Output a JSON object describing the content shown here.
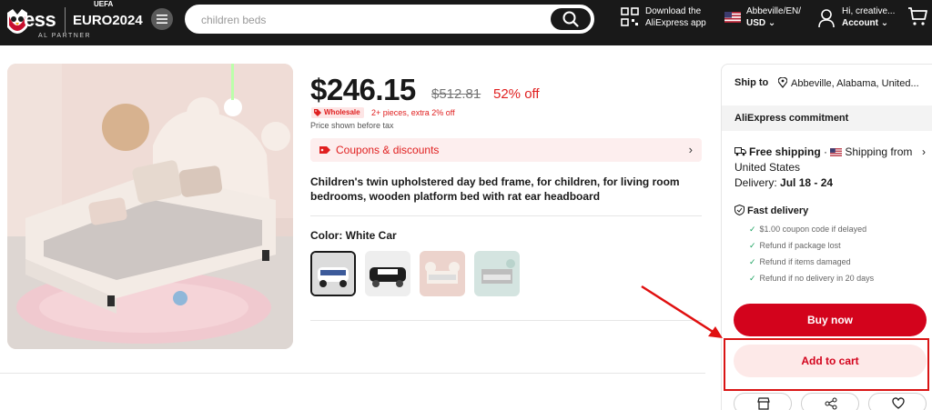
{
  "header": {
    "logo_text": "ess",
    "logo_euro": "EURO2024",
    "logo_uefa": "UEFA",
    "logo_partner": "AL PARTNER",
    "search": {
      "placeholder": "children beds"
    },
    "download": {
      "line1": "Download the",
      "line2": "AliExpress app"
    },
    "region": {
      "line1": "Abbeville/EN/",
      "line2": "USD"
    },
    "account": {
      "line1": "Hi, creative...",
      "line2": "Account"
    }
  },
  "product": {
    "price": "$246.15",
    "original_price": "$512.81",
    "discount": "52% off",
    "wholesale_badge": "Wholesale",
    "wholesale_note": "2+ pieces, extra 2% off",
    "tax_note": "Price shown before tax",
    "coupons_label": "Coupons & discounts",
    "title": "Children's twin upholstered day bed frame, for children, for living room bedrooms, wooden platform bed with rat ear headboard",
    "color_label": "Color: White Car",
    "color_options": [
      {
        "name": "White Car",
        "selected": true
      },
      {
        "name": "Black Car",
        "selected": false
      },
      {
        "name": "Pink",
        "selected": false
      },
      {
        "name": "Grey",
        "selected": false
      }
    ]
  },
  "panel": {
    "ship_to_label": "Ship to",
    "ship_to_location": "Abbeville, Alabama, United...",
    "commitment_label": "AliExpress commitment",
    "free_shipping_bold": "Free shipping",
    "free_shipping_sep": " · ",
    "free_shipping_rest": "Shipping from United States",
    "delivery_prefix": "Delivery: ",
    "delivery_dates": "Jul 18 - 24",
    "fast_delivery": "Fast delivery",
    "guarantees": [
      "$1.00 coupon code if delayed",
      "Refund if package lost",
      "Refund if items damaged",
      "Refund if no delivery in 20 days"
    ],
    "buy_now": "Buy now",
    "add_to_cart": "Add to cart"
  },
  "colors": {
    "header_bg": "#191919",
    "accent_red": "#d3031c",
    "annotation_red": "#d91414"
  }
}
